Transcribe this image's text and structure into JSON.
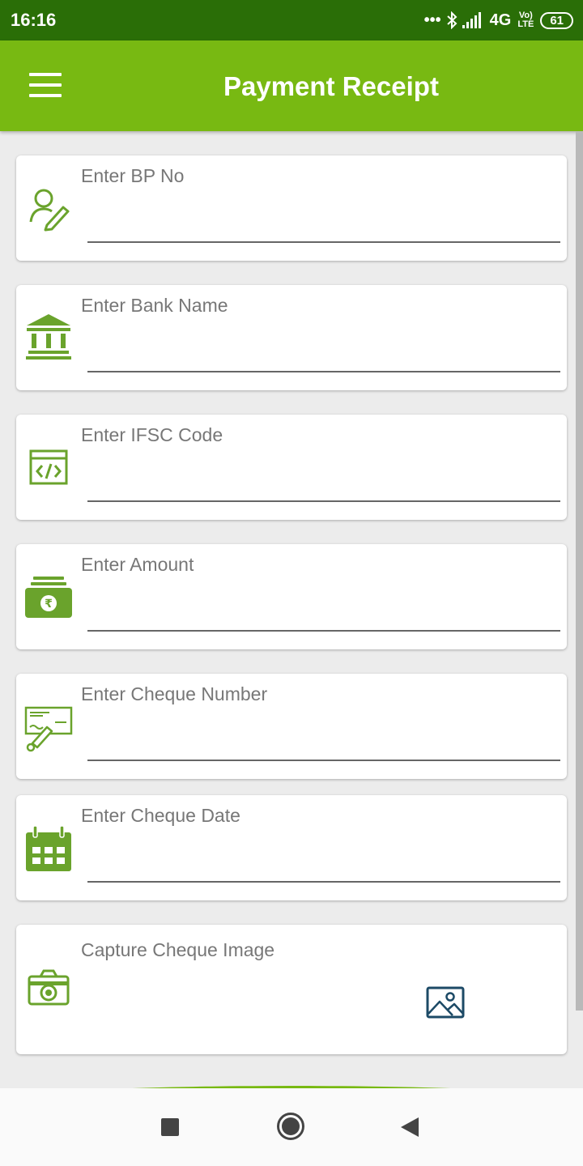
{
  "status_bar": {
    "time": "16:16",
    "network": "4G",
    "volte": "Vo) LTE",
    "battery": "61"
  },
  "app_bar": {
    "title": "Payment Receipt"
  },
  "form": {
    "bp_no": {
      "label": "Enter BP No",
      "value": ""
    },
    "bank_name": {
      "label": "Enter Bank Name",
      "value": ""
    },
    "ifsc_code": {
      "label": "Enter IFSC Code",
      "value": ""
    },
    "amount": {
      "label": "Enter Amount",
      "value": ""
    },
    "cheque_number": {
      "label": "Enter Cheque Number",
      "value": ""
    },
    "cheque_date": {
      "label": "Enter Cheque Date",
      "value": ""
    },
    "cheque_image": {
      "label": "Capture Cheque Image"
    }
  },
  "colors": {
    "status_bar": "#2a6e07",
    "app_bar": "#78b912",
    "icon_green": "#6aa32c",
    "image_icon": "#1c4a66"
  },
  "icons": {
    "menu": "hamburger-menu-icon",
    "bp_no": "user-edit-icon",
    "bank": "bank-building-icon",
    "ifsc": "code-window-icon",
    "amount": "rupee-money-icon",
    "cheque": "cheque-sign-icon",
    "date": "calendar-icon",
    "camera": "camera-icon",
    "image": "image-gallery-icon"
  }
}
